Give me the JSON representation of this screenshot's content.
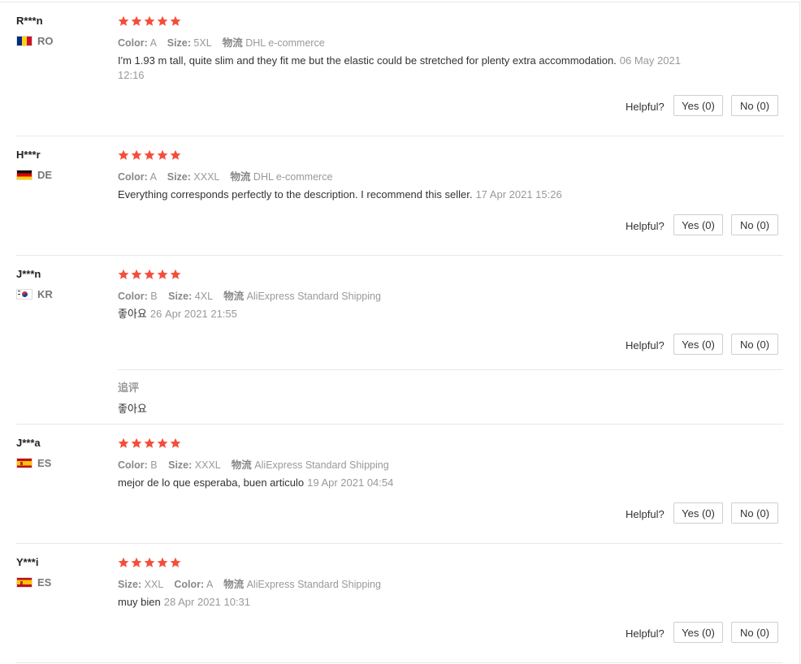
{
  "helpful_label": "Helpful?",
  "star_color": "#f44e3b",
  "reviews": [
    {
      "user": "R***n",
      "flag": "ro",
      "country": "RO",
      "stars": 5,
      "attrs": [
        {
          "k": "Color:",
          "v": "A"
        },
        {
          "k": "Size:",
          "v": "5XL"
        },
        {
          "k": "物流",
          "v": "DHL e-commerce"
        }
      ],
      "text": "I'm 1.93 m tall, quite slim and they fit me but the elastic could be stretched for plenty extra accommodation.",
      "date": "06 May 2021 12:16",
      "yes": "Yes (0)",
      "no": "No (0)"
    },
    {
      "user": "H***r",
      "flag": "de",
      "country": "DE",
      "stars": 5,
      "attrs": [
        {
          "k": "Color:",
          "v": "A"
        },
        {
          "k": "Size:",
          "v": "XXXL"
        },
        {
          "k": "物流",
          "v": "DHL e-commerce"
        }
      ],
      "text": "Everything corresponds perfectly to the description. I recommend this seller.",
      "date": "17 Apr 2021 15:26",
      "yes": "Yes (0)",
      "no": "No (0)"
    },
    {
      "user": "J***n",
      "flag": "kr",
      "country": "KR",
      "stars": 5,
      "attrs": [
        {
          "k": "Color:",
          "v": "B"
        },
        {
          "k": "Size:",
          "v": "4XL"
        },
        {
          "k": "物流",
          "v": "AliExpress Standard Shipping"
        }
      ],
      "text": "좋아요",
      "date": "26 Apr 2021 21:55",
      "yes": "Yes (0)",
      "no": "No (0)",
      "followup_label": "追评",
      "followup_text": "좋아요"
    },
    {
      "user": "J***a",
      "flag": "es",
      "country": "ES",
      "stars": 5,
      "attrs": [
        {
          "k": "Color:",
          "v": "B"
        },
        {
          "k": "Size:",
          "v": "XXXL"
        },
        {
          "k": "物流",
          "v": "AliExpress Standard Shipping"
        }
      ],
      "text": "mejor de lo que esperaba, buen articulo",
      "date": "19 Apr 2021 04:54",
      "yes": "Yes (0)",
      "no": "No (0)"
    },
    {
      "user": "Y***i",
      "flag": "es",
      "country": "ES",
      "stars": 5,
      "attrs": [
        {
          "k": "Size:",
          "v": "XXL"
        },
        {
          "k": "Color:",
          "v": "A"
        },
        {
          "k": "物流",
          "v": "AliExpress Standard Shipping"
        }
      ],
      "text": "muy bien",
      "date": "28 Apr 2021 10:31",
      "yes": "Yes (0)",
      "no": "No (0)"
    }
  ]
}
